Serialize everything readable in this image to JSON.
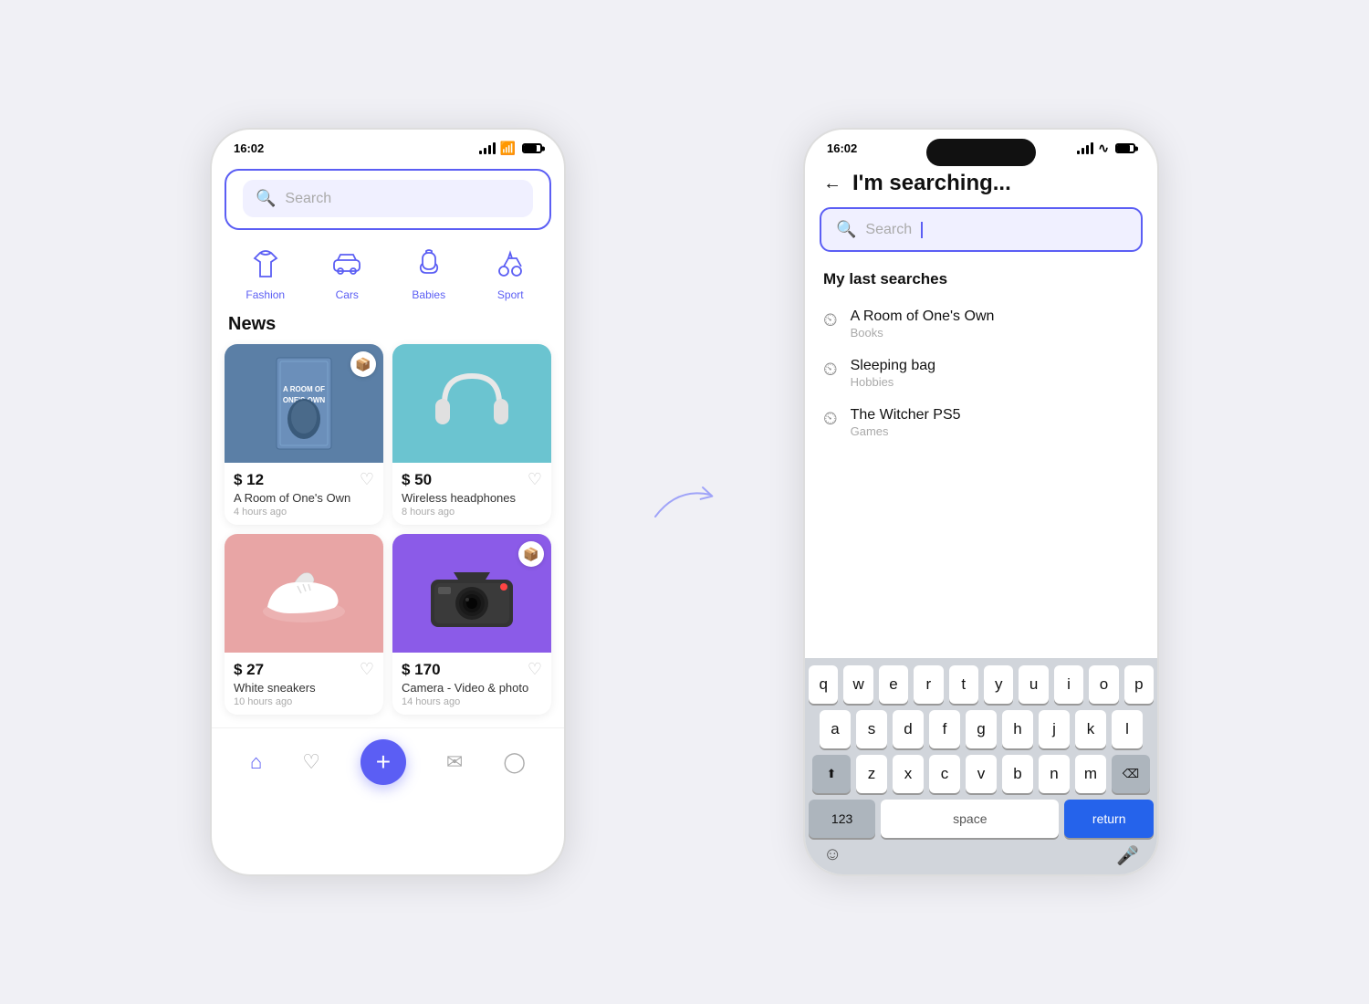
{
  "left_phone": {
    "time": "16:02",
    "search_placeholder": "Search",
    "categories": [
      {
        "id": "fashion",
        "label": "Fashion",
        "icon": "👟"
      },
      {
        "id": "cars",
        "label": "Cars",
        "icon": "🚗"
      },
      {
        "id": "babies",
        "label": "Babies",
        "icon": "🍼"
      },
      {
        "id": "sport",
        "label": "Sport",
        "icon": "🚲"
      }
    ],
    "news_title": "News",
    "products": [
      {
        "id": "book",
        "price": "$ 12",
        "name": "A Room of One's Own",
        "time": "4 hours ago",
        "bg": "book",
        "emoji": "📖",
        "badge": true
      },
      {
        "id": "headphones",
        "price": "$ 50",
        "name": "Wireless headphones",
        "time": "8 hours ago",
        "bg": "headphones",
        "emoji": "🎧",
        "badge": false
      },
      {
        "id": "shoes",
        "price": "$ 27",
        "name": "White sneakers",
        "time": "10 hours ago",
        "bg": "shoes",
        "emoji": "👟",
        "badge": false
      },
      {
        "id": "camera",
        "price": "$ 170",
        "name": "Camera - Video & photo",
        "time": "14 hours ago",
        "bg": "camera",
        "emoji": "📷",
        "badge": true
      }
    ],
    "nav": [
      "home",
      "heart",
      "plus",
      "mail",
      "user"
    ]
  },
  "right_phone": {
    "time": "16:02",
    "back_label": "←",
    "page_title": "I'm searching...",
    "search_placeholder": "Search",
    "last_searches_title": "My last searches",
    "searches": [
      {
        "name": "A Room of One's Own",
        "category": "Books"
      },
      {
        "name": "Sleeping bag",
        "category": "Hobbies"
      },
      {
        "name": "The Witcher PS5",
        "category": "Games"
      }
    ],
    "keyboard": {
      "row1": [
        "q",
        "w",
        "e",
        "r",
        "t",
        "y",
        "u",
        "i",
        "o",
        "p"
      ],
      "row2": [
        "a",
        "s",
        "d",
        "f",
        "g",
        "h",
        "j",
        "k",
        "l"
      ],
      "row3": [
        "z",
        "x",
        "c",
        "v",
        "b",
        "n",
        "m"
      ],
      "space_label": "space",
      "return_label": "return",
      "num_label": "123"
    }
  }
}
